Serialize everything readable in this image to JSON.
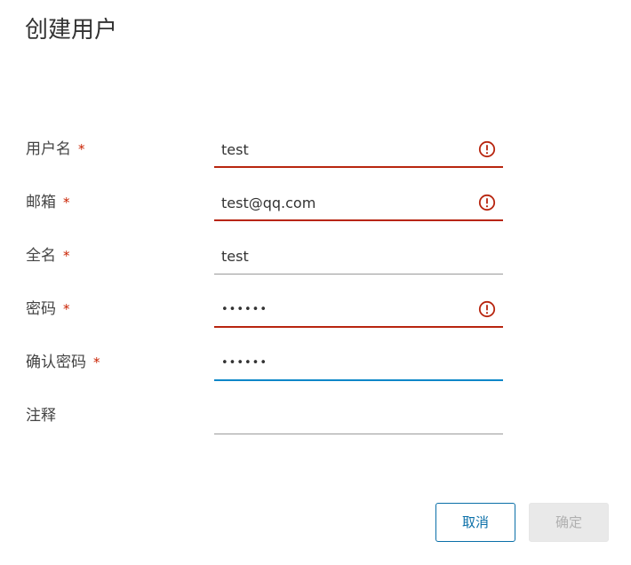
{
  "dialog": {
    "title": "创建用户"
  },
  "form": {
    "required_mark": "*",
    "fields": [
      {
        "label": "用户名",
        "value": "test",
        "required": true,
        "state": "error"
      },
      {
        "label": "邮箱",
        "value": "test@qq.com",
        "required": true,
        "state": "error"
      },
      {
        "label": "全名",
        "value": "test",
        "required": true,
        "state": "normal"
      },
      {
        "label": "密码",
        "value": "••••••",
        "required": true,
        "state": "error"
      },
      {
        "label": "确认密码",
        "value": "••••••",
        "required": true,
        "state": "focus"
      },
      {
        "label": "注释",
        "value": "",
        "required": false,
        "state": "normal"
      }
    ]
  },
  "footer": {
    "cancel_label": "取消",
    "ok_label": "确定"
  },
  "colors": {
    "error": "#b8250f",
    "focus": "#0a87c8",
    "primary_outline": "#0a6fa8",
    "disabled_bg": "#e9e9e9"
  },
  "icons": {
    "error": "exclamation-circle-icon"
  }
}
